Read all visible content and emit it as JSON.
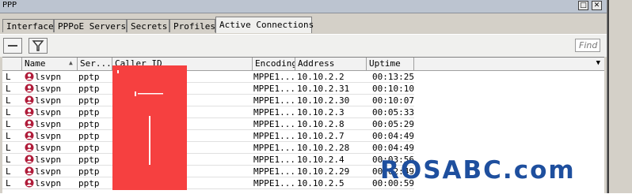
{
  "window": {
    "title": "PPP",
    "buttons": [
      "□",
      "✕"
    ]
  },
  "tabs": [
    {
      "label": "Interface",
      "active": false
    },
    {
      "label": "PPPoE Servers",
      "active": false
    },
    {
      "label": "Secrets",
      "active": false
    },
    {
      "label": "Profiles",
      "active": false
    },
    {
      "label": "Active Connections",
      "active": true
    }
  ],
  "toolbar": {
    "remove_icon": "minus-icon",
    "filter_icon": "filter-icon",
    "find_placeholder": "Find"
  },
  "table": {
    "headers": {
      "name": "Name",
      "service": "Ser...",
      "caller_id": "Caller ID",
      "encoding": "Encoding",
      "address": "Address",
      "uptime": "Uptime"
    },
    "rows": [
      {
        "flag": "L",
        "name": "lsvpn",
        "service": "pptp",
        "encoding": "MPPE1...",
        "address": "10.10.2.2",
        "uptime": "00:13:25"
      },
      {
        "flag": "L",
        "name": "lsvpn",
        "service": "pptp",
        "encoding": "MPPE1...",
        "address": "10.10.2.31",
        "uptime": "00:10:10"
      },
      {
        "flag": "L",
        "name": "lsvpn",
        "service": "pptp",
        "encoding": "MPPE1...",
        "address": "10.10.2.30",
        "uptime": "00:10:07"
      },
      {
        "flag": "L",
        "name": "lsvpn",
        "service": "pptp",
        "encoding": "MPPE1...",
        "address": "10.10.2.3",
        "uptime": "00:05:33"
      },
      {
        "flag": "L",
        "name": "lsvpn",
        "service": "pptp",
        "encoding": "MPPE1...",
        "address": "10.10.2.8",
        "uptime": "00:05:29"
      },
      {
        "flag": "L",
        "name": "lsvpn",
        "service": "pptp",
        "encoding": "MPPE1...",
        "address": "10.10.2.7",
        "uptime": "00:04:49"
      },
      {
        "flag": "L",
        "name": "lsvpn",
        "service": "pptp",
        "encoding": "MPPE1...",
        "address": "10.10.2.28",
        "uptime": "00:04:49"
      },
      {
        "flag": "L",
        "name": "lsvpn",
        "service": "pptp",
        "encoding": "MPPE1...",
        "address": "10.10.2.4",
        "uptime": "00:03:56"
      },
      {
        "flag": "L",
        "name": "lsvpn",
        "service": "pptp",
        "encoding": "MPPE1...",
        "address": "10.10.2.29",
        "uptime": "00:02:49"
      },
      {
        "flag": "L",
        "name": "lsvpn",
        "service": "pptp",
        "encoding": "MPPE1...",
        "address": "10.10.2.5",
        "uptime": "00:00:59"
      }
    ]
  },
  "watermark": "ROSABC.com",
  "colors": {
    "redaction": "#f64040",
    "watermark": "#1e4f9e",
    "user_icon": "#b01c3a"
  }
}
